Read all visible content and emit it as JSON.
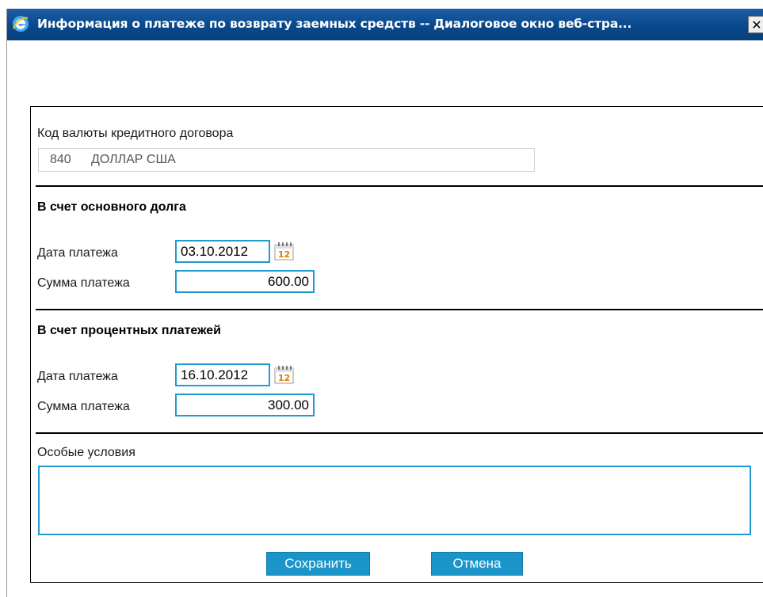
{
  "window": {
    "title": "Информация о платеже по возврату заемных средств -- Диалоговое окно веб-стра...",
    "close_label": "✕"
  },
  "currency": {
    "label": "Код валюты кредитного договора",
    "code": "840",
    "name": "ДОЛЛАР США"
  },
  "principal": {
    "title": "В счет основного долга",
    "date_label": "Дата платежа",
    "date_value": "03.10.2012",
    "sum_label": "Сумма платежа",
    "sum_value": "600.00"
  },
  "interest": {
    "title": "В счет процентных платежей",
    "date_label": "Дата платежа",
    "date_value": "16.10.2012",
    "sum_label": "Сумма платежа",
    "sum_value": "300.00"
  },
  "conditions": {
    "label": "Особые условия",
    "value": ""
  },
  "buttons": {
    "save": "Сохранить",
    "cancel": "Отмена"
  },
  "icons": {
    "window": "ie-icon",
    "calendar": "calendar-icon",
    "calendar_number": "12"
  },
  "colors": {
    "titlebar": "#0a4a8f",
    "accent": "#1f9bd1",
    "button": "#1b95c9"
  }
}
